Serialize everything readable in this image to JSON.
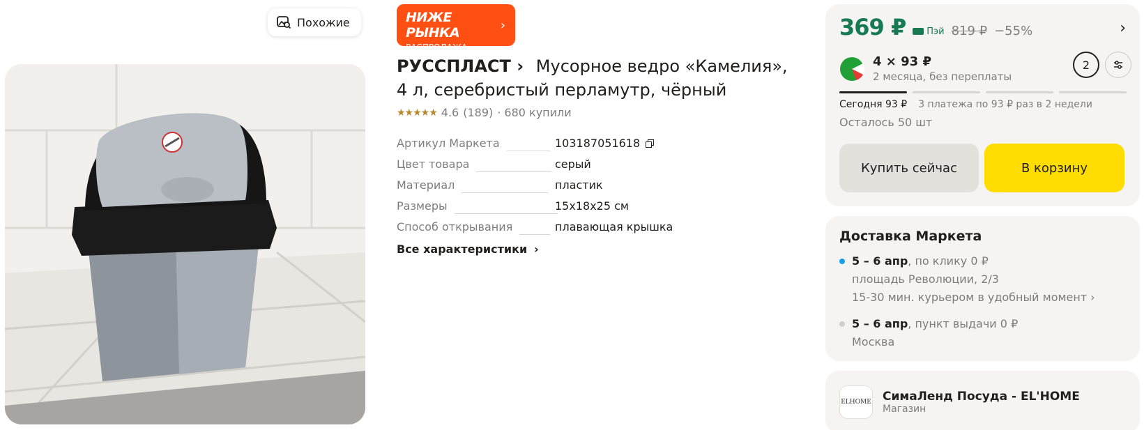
{
  "gallery": {
    "similar_label": "Похожие"
  },
  "badge": {
    "title": "НИЖЕ РЫНКА",
    "subtitle": "РАСПРОДАЖА",
    "color": "#ff4f12"
  },
  "product": {
    "brand": "РУССПЛАСТ",
    "title": "Мусорное ведро «Камелия», 4 л, серебристый перламутр, чёрный",
    "rating": "4.6",
    "reviews": "(189)",
    "bought": "· 680 купили",
    "stars": "★★★★★",
    "specs": [
      {
        "label": "Артикул Маркета",
        "value": "103187051618"
      },
      {
        "label": "Цвет товара",
        "value": "серый"
      },
      {
        "label": "Материал",
        "value": "пластик"
      },
      {
        "label": "Размеры",
        "value": "15x18x25 см"
      },
      {
        "label": "Способ открывания",
        "value": "плавающая крышка"
      }
    ],
    "all_specs_label": "Все характеристики"
  },
  "price": {
    "current": "369 ₽",
    "pay_label": "Пэй",
    "old": "819 ₽",
    "discount": "−55%",
    "accent": "#177a53"
  },
  "split": {
    "amount": "4 × 93 ₽",
    "period": "2 месяца, без переплаты",
    "count": "2",
    "today": "Сегодня 93 ₽",
    "rest": "3 платежа по 93 ₽ раз в 2 недели",
    "progress_active_segments": 1,
    "progress_total_segments": 4
  },
  "stock": "Осталось 50 шт",
  "buttons": {
    "buy_now": "Купить сейчас",
    "add_to_cart": "В корзину",
    "cart_color": "#ffdd00"
  },
  "delivery": {
    "title": "Доставка Маркета",
    "options": [
      {
        "date": "5 – 6 апр",
        "type": ", по клику",
        "price": "0 ₽",
        "lines": [
          "площадь Революции, 2/3",
          "15-30 мин. курьером в удобный момент ›"
        ],
        "dot_color": "#1a9ee6"
      },
      {
        "date": "5 – 6 апр",
        "type": ", пункт выдачи",
        "price": "0 ₽",
        "lines": [
          "Москва"
        ],
        "dot_color": "#d0cfcb"
      }
    ]
  },
  "shop": {
    "logo_text": "ELHOME",
    "name": "СимаЛенд Посуда - EL'HOME",
    "type": "Магазин"
  }
}
